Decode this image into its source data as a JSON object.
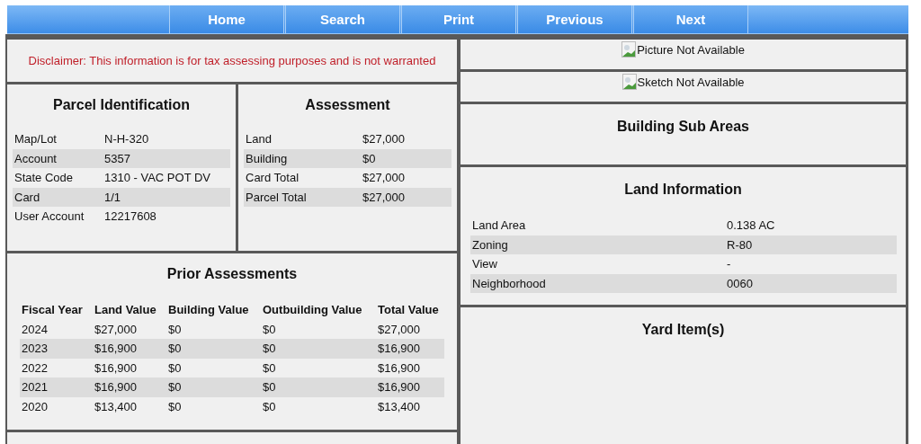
{
  "nav": [
    {
      "label": "Home"
    },
    {
      "label": "Search"
    },
    {
      "label": "Print"
    },
    {
      "label": "Previous"
    },
    {
      "label": "Next"
    }
  ],
  "disclaimer": "Disclaimer: This information is for tax assessing purposes and is not warranted",
  "parcel_identification": {
    "title": "Parcel Identification",
    "rows": [
      {
        "label": "Map/Lot",
        "value": "N-H-320"
      },
      {
        "label": "Account",
        "value": "5357"
      },
      {
        "label": "State Code",
        "value": "1310 - VAC POT DV"
      },
      {
        "label": "Card",
        "value": "1/1"
      },
      {
        "label": "User Account",
        "value": "12217608"
      }
    ]
  },
  "assessment": {
    "title": "Assessment",
    "rows": [
      {
        "label": "Land",
        "value": "$27,000"
      },
      {
        "label": "Building",
        "value": "$0"
      },
      {
        "label": "Card Total",
        "value": "$27,000"
      },
      {
        "label": "Parcel Total",
        "value": "$27,000"
      }
    ]
  },
  "prior_assessments": {
    "title": "Prior Assessments",
    "columns": [
      "Fiscal Year",
      "Land Value",
      "Building Value",
      "Outbuilding Value",
      "Total Value"
    ],
    "rows": [
      [
        "2024",
        "$27,000",
        "$0",
        "$0",
        "$27,000"
      ],
      [
        "2023",
        "$16,900",
        "$0",
        "$0",
        "$16,900"
      ],
      [
        "2022",
        "$16,900",
        "$0",
        "$0",
        "$16,900"
      ],
      [
        "2021",
        "$16,900",
        "$0",
        "$0",
        "$16,900"
      ],
      [
        "2020",
        "$13,400",
        "$0",
        "$0",
        "$13,400"
      ]
    ]
  },
  "picture": {
    "alt": "Picture Not Available"
  },
  "sketch": {
    "alt": "Sketch Not Available"
  },
  "building_sub_areas": {
    "title": "Building Sub Areas"
  },
  "land_information": {
    "title": "Land Information",
    "rows": [
      {
        "label": "Land Area",
        "value": "0.138 AC"
      },
      {
        "label": "Zoning",
        "value": "R-80"
      },
      {
        "label": "View",
        "value": "-"
      },
      {
        "label": "Neighborhood",
        "value": "0060"
      }
    ]
  },
  "yard_items": {
    "title": "Yard Item(s)"
  }
}
